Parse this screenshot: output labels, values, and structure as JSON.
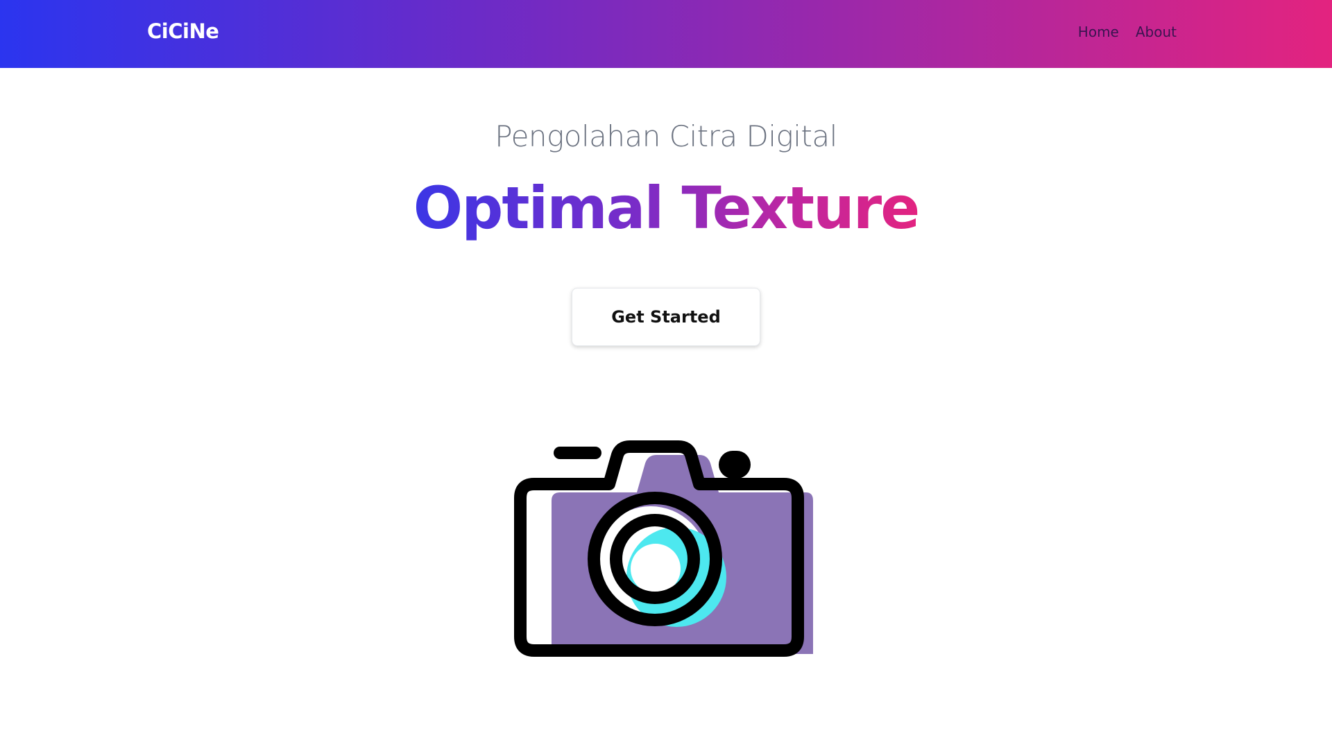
{
  "nav": {
    "brand": "CiCiNe",
    "links": [
      {
        "label": "Home"
      },
      {
        "label": "About"
      }
    ]
  },
  "hero": {
    "subtitle": "Pengolahan Citra Digital",
    "headline": "Optimal Texture",
    "cta_label": "Get Started"
  },
  "illustration": {
    "icon": "camera-icon",
    "colors": {
      "outline": "#000000",
      "body_fill": "#8b74b6",
      "lens_accent": "#4de8ef"
    }
  },
  "theme": {
    "gradient_start": "#2b35ef",
    "gradient_end": "#e3237f"
  }
}
